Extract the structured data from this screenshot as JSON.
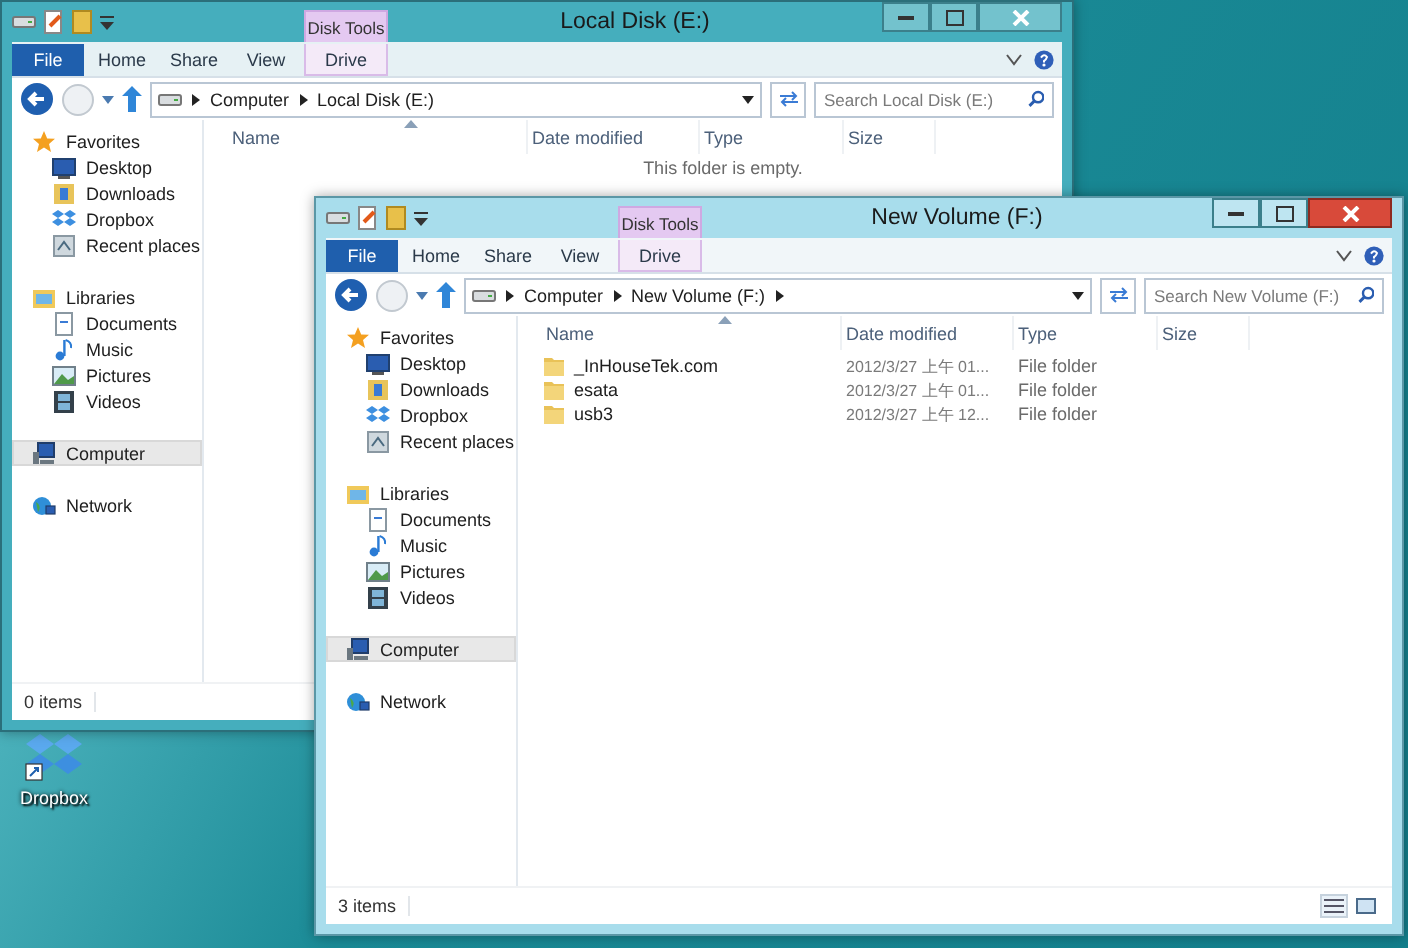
{
  "desktop": {
    "icons": [
      {
        "label": "Dropbox"
      }
    ]
  },
  "windows": [
    {
      "title": "Local Disk (E:)",
      "active": false,
      "contextual_group": {
        "label": "Disk Tools"
      },
      "tabs": [
        {
          "label": "File",
          "kind": "file"
        },
        {
          "label": "Home",
          "kind": "tab"
        },
        {
          "label": "Share",
          "kind": "tab"
        },
        {
          "label": "View",
          "kind": "tab"
        },
        {
          "label": "Drive",
          "kind": "contextual"
        }
      ],
      "breadcrumb": [
        "Computer",
        "Local Disk (E:)"
      ],
      "trailing_arrow": false,
      "search": {
        "placeholder": "Search Local Disk (E:)"
      },
      "nav": [
        {
          "label": "Favorites",
          "kind": "favorites",
          "selected": false,
          "children": [
            {
              "label": "Desktop",
              "kind": "desktop",
              "selected": false
            },
            {
              "label": "Downloads",
              "kind": "downloads",
              "selected": false
            },
            {
              "label": "Dropbox",
              "kind": "dropbox",
              "selected": false
            },
            {
              "label": "Recent places",
              "kind": "recent",
              "selected": false
            }
          ]
        },
        {
          "label": "Libraries",
          "kind": "libraries",
          "selected": false,
          "children": [
            {
              "label": "Documents",
              "kind": "documents",
              "selected": false
            },
            {
              "label": "Music",
              "kind": "music",
              "selected": false
            },
            {
              "label": "Pictures",
              "kind": "pictures",
              "selected": false
            },
            {
              "label": "Videos",
              "kind": "videos",
              "selected": false
            }
          ]
        },
        {
          "label": "Computer",
          "kind": "computer",
          "selected": true
        },
        {
          "label": "Network",
          "kind": "network",
          "selected": false
        }
      ],
      "columns": [
        "Name",
        "Date modified",
        "Type",
        "Size"
      ],
      "empty_message": "This folder is empty.",
      "status_bar": {
        "text": "0 items"
      }
    },
    {
      "title": "New Volume (F:)",
      "active": true,
      "contextual_group": {
        "label": "Disk Tools"
      },
      "tabs": [
        {
          "label": "File",
          "kind": "file"
        },
        {
          "label": "Home",
          "kind": "tab"
        },
        {
          "label": "Share",
          "kind": "tab"
        },
        {
          "label": "View",
          "kind": "tab"
        },
        {
          "label": "Drive",
          "kind": "contextual"
        }
      ],
      "breadcrumb": [
        "Computer",
        "New Volume (F:)"
      ],
      "trailing_arrow": true,
      "search": {
        "placeholder": "Search New Volume (F:)"
      },
      "nav": [
        {
          "label": "Favorites",
          "kind": "favorites",
          "selected": false,
          "children": [
            {
              "label": "Desktop",
              "kind": "desktop",
              "selected": false
            },
            {
              "label": "Downloads",
              "kind": "downloads",
              "selected": false
            },
            {
              "label": "Dropbox",
              "kind": "dropbox",
              "selected": false
            },
            {
              "label": "Recent places",
              "kind": "recent",
              "selected": false
            }
          ]
        },
        {
          "label": "Libraries",
          "kind": "libraries",
          "selected": false,
          "children": [
            {
              "label": "Documents",
              "kind": "documents",
              "selected": false
            },
            {
              "label": "Music",
              "kind": "music",
              "selected": false
            },
            {
              "label": "Pictures",
              "kind": "pictures",
              "selected": false
            },
            {
              "label": "Videos",
              "kind": "videos",
              "selected": false
            }
          ]
        },
        {
          "label": "Computer",
          "kind": "computer",
          "selected": true
        },
        {
          "label": "Network",
          "kind": "network",
          "selected": false
        }
      ],
      "columns": [
        "Name",
        "Date modified",
        "Type",
        "Size"
      ],
      "files": [
        {
          "name": "_InHouseTek.com",
          "date": "2012/3/27 上午 01...",
          "type": "File folder"
        },
        {
          "name": "esata",
          "date": "2012/3/27 上午 01...",
          "type": "File folder"
        },
        {
          "name": "usb3",
          "date": "2012/3/27 上午 12...",
          "type": "File folder"
        }
      ],
      "status_bar": {
        "text": "3 items",
        "view_buttons": true
      }
    }
  ]
}
